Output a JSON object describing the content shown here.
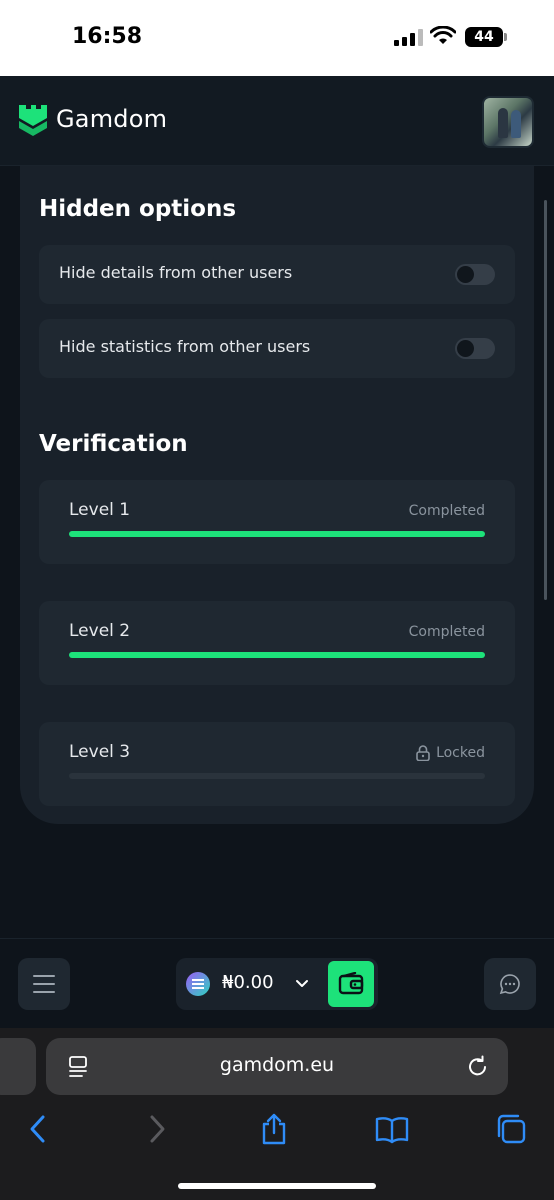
{
  "status_bar": {
    "time": "16:58",
    "battery": "44"
  },
  "header": {
    "brand": "Gamdom"
  },
  "hidden_options": {
    "title": "Hidden options",
    "items": [
      {
        "label": "Hide details from other users",
        "enabled": false
      },
      {
        "label": "Hide statistics from other users",
        "enabled": false
      }
    ]
  },
  "verification": {
    "title": "Verification",
    "levels": [
      {
        "name": "Level 1",
        "status": "Completed",
        "progress": 1.0
      },
      {
        "name": "Level 2",
        "status": "Completed",
        "progress": 1.0
      },
      {
        "name": "Level 3",
        "status": "Locked",
        "progress": 0.0
      }
    ]
  },
  "bottom_nav": {
    "balance": "₦0.00"
  },
  "browser": {
    "url": "gamdom.eu"
  },
  "colors": {
    "accent": "#1de27a",
    "background": "#0e141b",
    "card": "#19212a",
    "row": "#1f2831"
  }
}
